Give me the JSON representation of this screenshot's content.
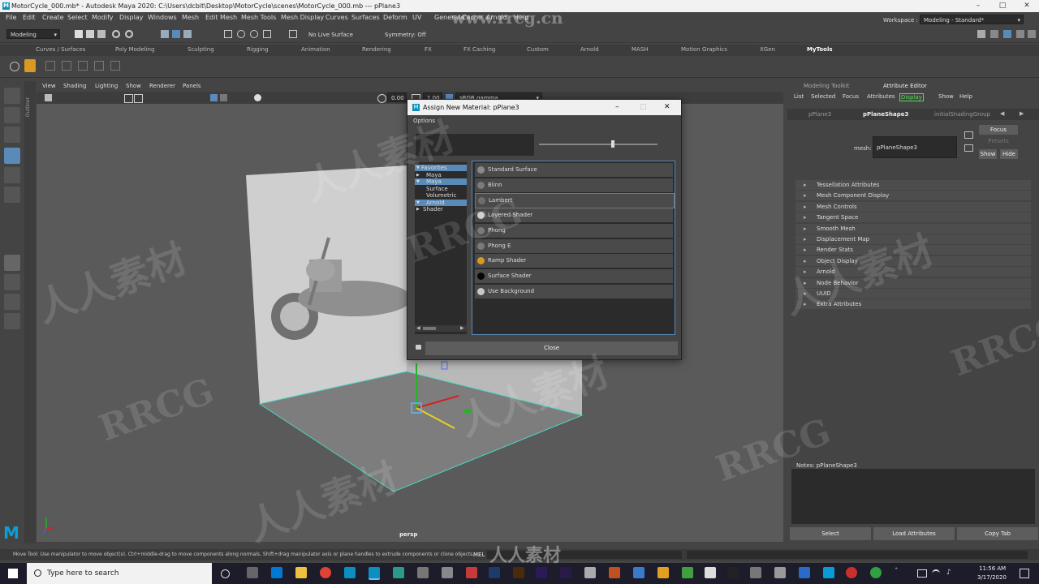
{
  "window": {
    "title": "MotorCycle_000.mb* - Autodesk Maya 2020: C:\\Users\\dcbit\\Desktop\\MotorCycle\\scenes\\MotorCycle_000.mb  ---  pPlane3"
  },
  "menu": [
    "File",
    "Edit",
    "Create",
    "Select",
    "Modify",
    "Display",
    "Windows",
    "Mesh",
    "Edit Mesh",
    "Mesh Tools",
    "Mesh Display",
    "Curves",
    "Surfaces",
    "Deform",
    "UV",
    "Generate",
    "Cache",
    "Arnold",
    "Help"
  ],
  "statusline": {
    "menuset": "Modeling",
    "live_surface": "No Live Surface",
    "symmetry": "Symmetry: Off",
    "workspace_label": "Workspace :",
    "workspace_value": "Modeling - Standard*"
  },
  "shelf_tabs": [
    "Curves / Surfaces",
    "Poly Modeling",
    "Sculpting",
    "Rigging",
    "Animation",
    "Rendering",
    "FX",
    "FX Caching",
    "Custom",
    "Arnold",
    "MASH",
    "Motion Graphics",
    "XGen",
    "MyTools"
  ],
  "outliner_label": "Outliner",
  "viewport": {
    "menu": [
      "View",
      "Shading",
      "Lighting",
      "Show",
      "Renderer",
      "Panels"
    ],
    "field1": "0.00",
    "field2": "1.00",
    "colorspace": "sRGB gamma",
    "camera_label": "persp"
  },
  "dialog": {
    "title": "Assign New Material: pPlane3",
    "options_menu": "Options",
    "tree": [
      {
        "label": "Favorites",
        "selected": true
      },
      {
        "label": "Maya",
        "selected": false
      },
      {
        "label": "Maya",
        "selected": true
      },
      {
        "label": "Surface",
        "selected": false
      },
      {
        "label": "Volumetric",
        "selected": false
      },
      {
        "label": "Arnold",
        "selected": true
      },
      {
        "label": "Shader",
        "selected": false
      }
    ],
    "materials": [
      {
        "label": "Standard Surface",
        "color": "#8a8a8a"
      },
      {
        "label": "Blinn",
        "color": "#7a7a7a"
      },
      {
        "label": "Lambert",
        "color": "#6e6e6e"
      },
      {
        "label": "Layered Shader",
        "color": "#d0d0d0"
      },
      {
        "label": "Phong",
        "color": "#7a7a7a"
      },
      {
        "label": "Phong E",
        "color": "#7a7a7a"
      },
      {
        "label": "Ramp Shader",
        "color": "#d89a20"
      },
      {
        "label": "Surface Shader",
        "color": "#050505"
      },
      {
        "label": "Use Background",
        "color": "#c8c8c8"
      }
    ],
    "close_label": "Close"
  },
  "attribute_editor": {
    "panel_tabs": [
      "Modeling Toolkit",
      "Attribute Editor"
    ],
    "menu": [
      "List",
      "Selected",
      "Focus",
      "Attributes",
      "Display",
      "Show",
      "Help"
    ],
    "node_tabs": [
      "pPlane3",
      "pPlaneShape3",
      "initialShadingGroup"
    ],
    "focus_label": "Focus",
    "presets_label": "Presets",
    "show_label": "Show",
    "hide_label": "Hide",
    "mesh_label": "mesh:",
    "mesh_value": "pPlaneShape3",
    "sections": [
      "Tessellation Attributes",
      "Mesh Component Display",
      "Mesh Controls",
      "Tangent Space",
      "Smooth Mesh",
      "Displacement Map",
      "Render Stats",
      "Object Display",
      "Arnold",
      "Node Behavior",
      "UUID",
      "Extra Attributes"
    ],
    "notes_label": "Notes:  pPlaneShape3",
    "buttons": [
      "Select",
      "Load Attributes",
      "Copy Tab"
    ]
  },
  "helpline": "Move Tool: Use manipulator to move object(s). Ctrl+middle-drag to move components along normals. Shift+drag manipulator axis or plane handles to extrude components or clone objects.",
  "script_lang": "MEL",
  "taskbar": {
    "search_placeholder": "Type here to search",
    "time": "11:56 AM",
    "date": "3/17/2020"
  },
  "watermarks": [
    "www.rrcg.cn",
    "RRCG",
    "人人素材"
  ]
}
